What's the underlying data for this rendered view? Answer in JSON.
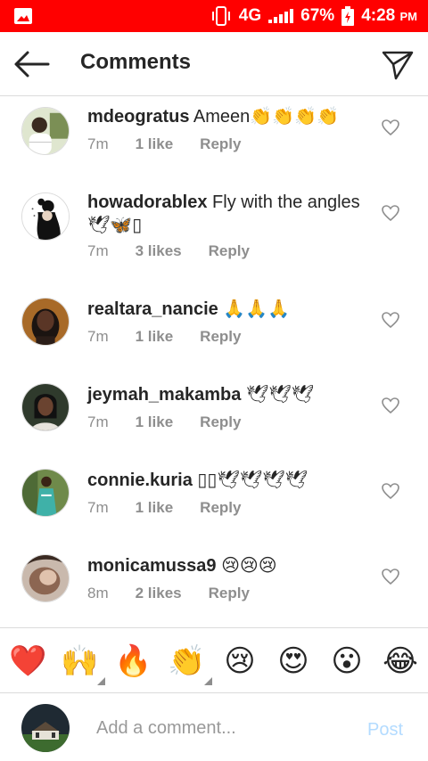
{
  "status_bar": {
    "network": "4G",
    "battery": "67%",
    "time": "4:28",
    "time_suffix": "PM",
    "icons": [
      "gallery-icon",
      "vibrate-icon",
      "signal-icon",
      "battery-charging-icon"
    ]
  },
  "header": {
    "title": "Comments",
    "back_icon": "arrow-left-icon",
    "share_icon": "send-icon"
  },
  "comments": [
    {
      "username": "mdeogratus",
      "text": "Ameen👏👏👏👏",
      "time": "7m",
      "likes": "1 like",
      "reply": "Reply"
    },
    {
      "username": "howadorablex",
      "text": "Fly with the angles 🕊🦋▯",
      "time": "7m",
      "likes": "3 likes",
      "reply": "Reply"
    },
    {
      "username": "realtara_nancie",
      "text": "🙏🙏🙏",
      "time": "7m",
      "likes": "1 like",
      "reply": "Reply"
    },
    {
      "username": "jeymah_makamba",
      "text": "🕊🕊🕊",
      "time": "7m",
      "likes": "1 like",
      "reply": "Reply"
    },
    {
      "username": "connie.kuria",
      "text": "▯▯🕊🕊🕊🕊",
      "time": "7m",
      "likes": "1 like",
      "reply": "Reply"
    },
    {
      "username": "monicamussa9",
      "text": "😢😢😢",
      "time": "8m",
      "likes": "2 likes",
      "reply": "Reply"
    }
  ],
  "emoji_bar": [
    "❤️",
    "🙌",
    "🔥",
    "👏",
    "😢",
    "😍",
    "😮",
    "😂"
  ],
  "composer": {
    "placeholder": "Add a comment...",
    "post_label": "Post"
  },
  "colors": {
    "status_bar": "#ff0000",
    "text": "#262626",
    "meta": "#8e8e8e",
    "divider": "#dbdbdb",
    "post_disabled": "#b3dbff"
  }
}
